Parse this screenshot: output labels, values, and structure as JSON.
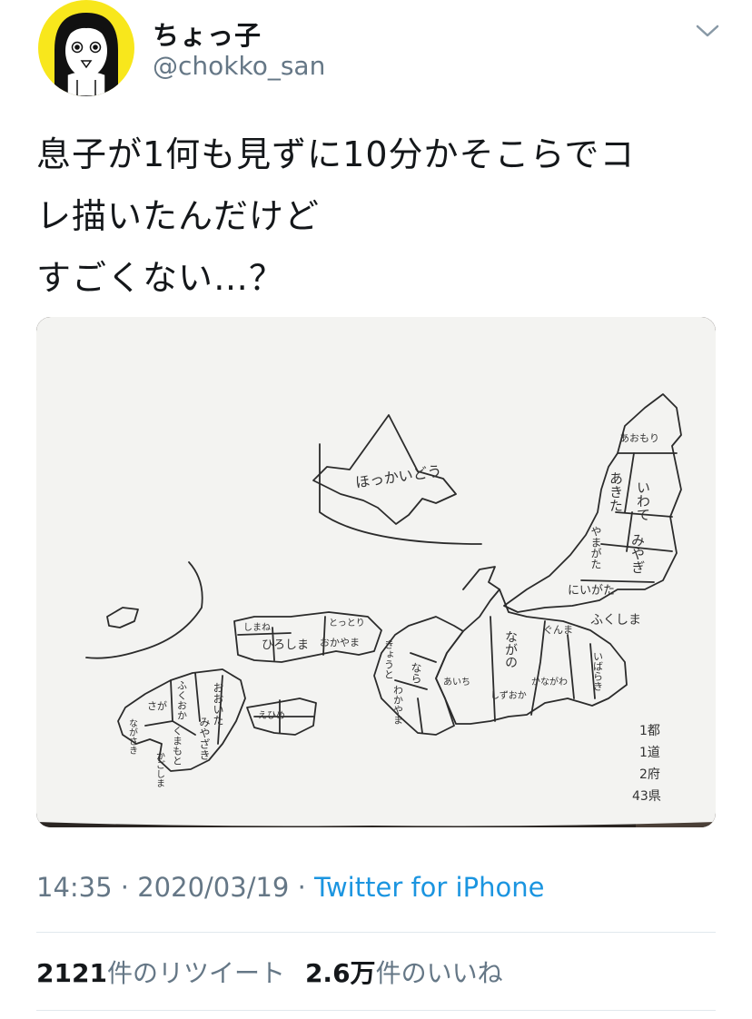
{
  "author": {
    "display_name": "ちょっ子",
    "handle": "@chokko_san",
    "avatar_icon": "cartoon-face-avatar",
    "avatar_bg": "#f8e71c"
  },
  "header": {
    "menu_icon": "chevron-down-icon"
  },
  "tweet": {
    "lines": [
      "息子が1何も見ずに10分かそこらでコ",
      "レ描いたんだけど",
      "すごくない…？"
    ]
  },
  "media": {
    "description_icon": "hand-drawn-japan-map-photo",
    "map_labels": {
      "hokkaido": "ほっかいどう",
      "aomori": "あおもり",
      "iwate": "いわて",
      "akita": "あきた",
      "miyagi": "みやぎ",
      "yamagata": "やまがた",
      "niigata": "にいがた",
      "fukushima": "ふくしま",
      "nagano": "ながの",
      "gunma": "ぐんま",
      "hiroshima": "ひろしま",
      "shimane": "しまね",
      "tottori": "とっとり",
      "okayama": "おかやま",
      "kyoto": "きょうと",
      "nara": "なら",
      "wakayama": "わかやま",
      "aichi": "あいち",
      "shizuoka": "しずおか",
      "kanagawa": "かながわ",
      "ibaraki": "いばらき",
      "saga": "さが",
      "fukuoka": "ふくおか",
      "kumamoto": "くまもと",
      "oita": "おおいた",
      "miyazaki": "みやざき",
      "nagasaki": "ながさき",
      "kagoshima": "かごしま",
      "ehime": "えひめ",
      "legend": [
        "1都",
        "1道",
        "2府",
        "43県"
      ]
    }
  },
  "meta": {
    "time": "14:35",
    "sep1": " · ",
    "date": "2020/03/19",
    "sep2": " · ",
    "client": "Twitter for iPhone",
    "link_color": "#1b95e0"
  },
  "stats": {
    "retweets_count": "2121",
    "retweets_label": "件のリツイート",
    "likes_count": "2.6万",
    "likes_label": "件のいいね"
  }
}
